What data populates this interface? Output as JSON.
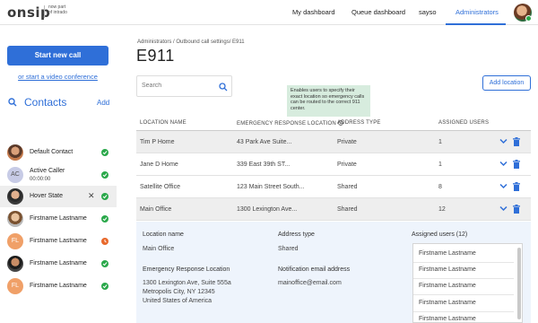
{
  "brand": {
    "logo": "onsip",
    "tagline_line1": "now part",
    "tagline_line2": "of intrado"
  },
  "nav": {
    "items": [
      "My dashboard",
      "Queue dashboard",
      "sayso",
      "Administrators"
    ],
    "active": "Administrators"
  },
  "sidebar": {
    "start_call": "Start new call",
    "video_link": "or start a video conference",
    "contacts_title": "Contacts",
    "contacts_add": "Add",
    "contacts": [
      {
        "name": "Default Contact",
        "sub": "",
        "avatar": "photo",
        "status": "available"
      },
      {
        "name": "Active Caller",
        "sub": "00:00:00",
        "avatar": "AC",
        "status": "available"
      },
      {
        "name": "Hover State",
        "sub": "",
        "avatar": "photo",
        "status": "available",
        "hovered": true
      },
      {
        "name": "Firstname Lastname",
        "sub": "",
        "avatar": "photo",
        "status": "available"
      },
      {
        "name": "Firstname Lastname",
        "sub": "",
        "avatar": "FL",
        "status": "away"
      },
      {
        "name": "Firstname Lastname",
        "sub": "",
        "avatar": "photo",
        "status": "available"
      },
      {
        "name": "Firstname Lastname",
        "sub": "",
        "avatar": "FL",
        "status": "available"
      }
    ]
  },
  "main": {
    "breadcrumb": "Administrators / Outbound call settings/ E911",
    "title": "E911",
    "search_placeholder": "Search",
    "tooltip": "Enables users to specify their exact location so emergency calls can be routed to the correct 911 center.",
    "add_location": "Add location",
    "columns": [
      "LOCATION NAME",
      "EMERGENCY RESPONSE LOCATION",
      "ADDRESS TYPE",
      "ASSIGNED USERS"
    ],
    "rows": [
      {
        "name": "Tim P Home",
        "address": "43 Park Ave Suite...",
        "type": "Private",
        "users": "1"
      },
      {
        "name": "Jane D Home",
        "address": "339 East 39th ST...",
        "type": "Private",
        "users": "1"
      },
      {
        "name": "Satellite Office",
        "address": "123 Main Street South...",
        "type": "Shared",
        "users": "8"
      },
      {
        "name": "Main Office",
        "address": "1300 Lexington Ave...",
        "type": "Shared",
        "users": "12"
      }
    ],
    "detail": {
      "location_name_label": "Location name",
      "location_name": "Main Office",
      "address_type_label": "Address type",
      "address_type": "Shared",
      "assigned_label": "Assigned users (12)",
      "erl_label": "Emergency Response Location",
      "erl_line1": "1300 Lexington Ave, Suite 555a",
      "erl_line2": "Metropolis City, NY 12345",
      "erl_line3": "United States of America",
      "email_label": "Notification email address",
      "email": "mainoffice@email.com",
      "assigned_users": [
        "Firstname Lastname",
        "Firstname Lastname",
        "Firstname Lastname",
        "Firstname Lastname",
        "Firstname Lastname"
      ]
    }
  },
  "colors": {
    "accent": "#2f6fd8",
    "available": "#2aa84a",
    "away": "#e8692c",
    "tooltip_bg": "#d7ecde",
    "detail_bg": "#eef4fc"
  }
}
